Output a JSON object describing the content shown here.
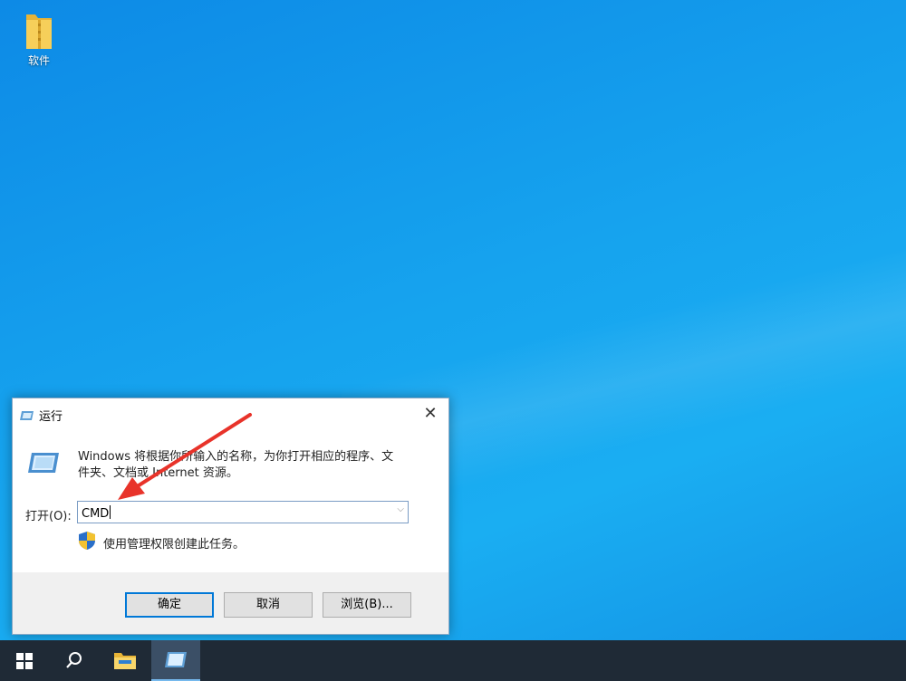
{
  "desktop": {
    "icons": [
      {
        "label": "软件",
        "icon": "folder-icon"
      }
    ]
  },
  "run_dialog": {
    "title": "运行",
    "close_glyph": "✕",
    "description_line1": "Windows 将根据你所输入的名称，为你打开相应的程序、文",
    "description_line2": "件夹、文档或 Internet 资源。",
    "open_label": "打开(O):",
    "input_value": "CMD",
    "admin_note": "使用管理权限创建此任务。",
    "buttons": {
      "ok": "确定",
      "cancel": "取消",
      "browse": "浏览(B)..."
    }
  },
  "taskbar": {
    "items": [
      "windows-start-icon",
      "search-icon",
      "file-explorer-icon",
      "run-app-icon"
    ]
  },
  "colors": {
    "desktop": "#1aa3ee",
    "taskbar": "#1f2a36",
    "accent": "#0078d7",
    "annotation_arrow": "#e8332a"
  }
}
